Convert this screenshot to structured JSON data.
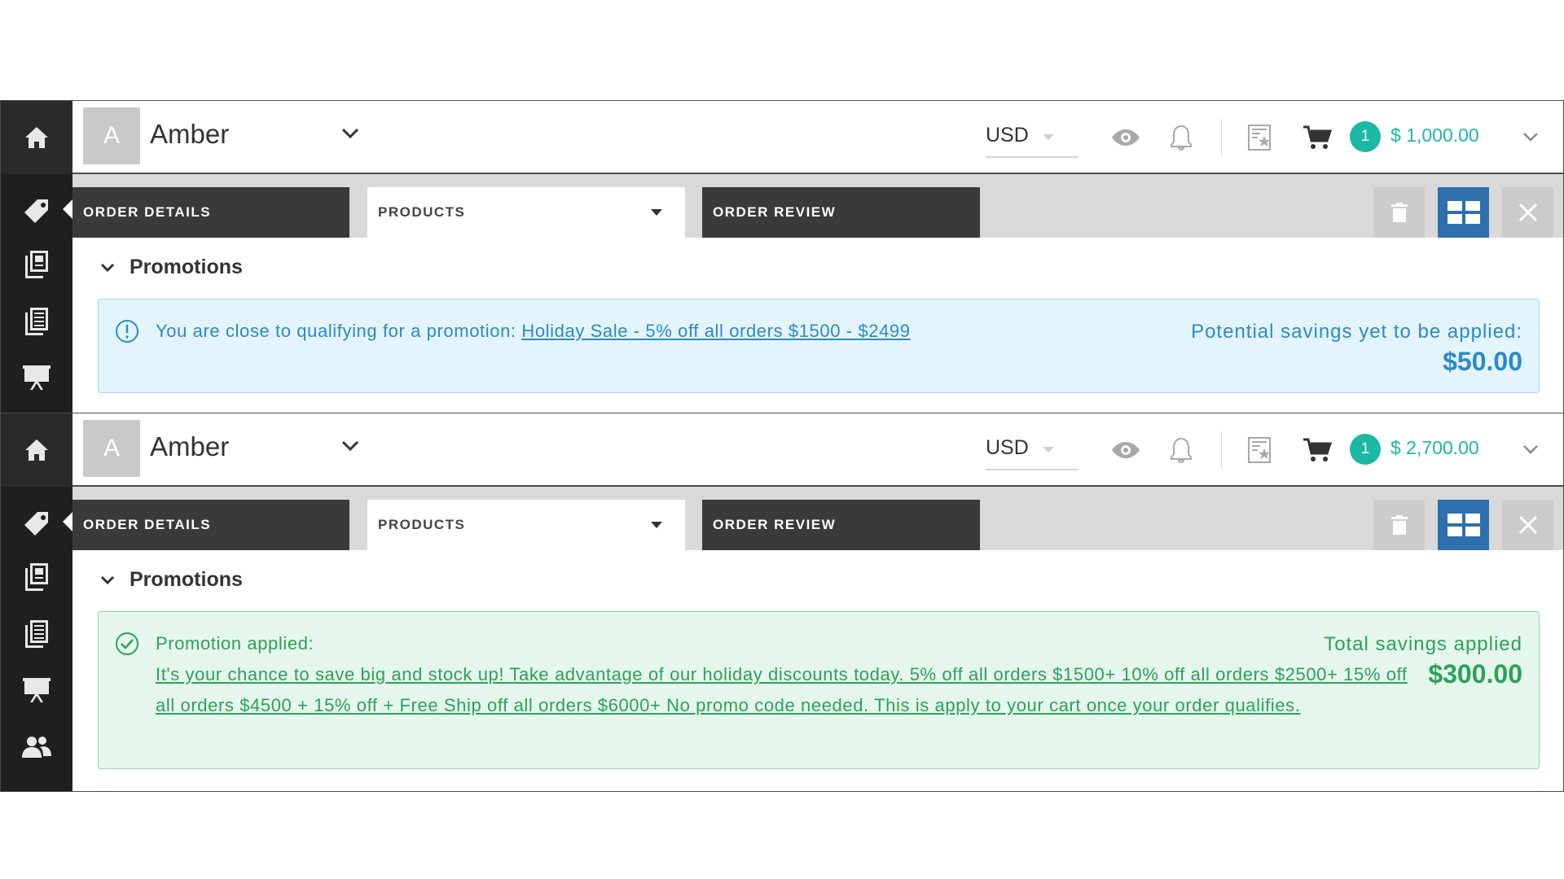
{
  "panels": [
    {
      "user": {
        "initial": "A",
        "name": "Amber"
      },
      "currency": "USD",
      "cart": {
        "count": "1",
        "total": "$ 1,000.00"
      },
      "tabs": {
        "order_details": "ORDER DETAILS",
        "products": "PRODUCTS",
        "order_review": "ORDER REVIEW"
      },
      "promotions": {
        "heading": "Promotions",
        "type": "info",
        "message": "You are close to qualifying for a promotion:",
        "link": "Holiday Sale - 5% off all orders $1500 - $2499",
        "savings_label": "Potential savings yet to be applied:",
        "savings_amount": "$50.00"
      }
    },
    {
      "user": {
        "initial": "A",
        "name": "Amber"
      },
      "currency": "USD",
      "cart": {
        "count": "1",
        "total": "$ 2,700.00"
      },
      "tabs": {
        "order_details": "ORDER DETAILS",
        "products": "PRODUCTS",
        "order_review": "ORDER REVIEW"
      },
      "promotions": {
        "heading": "Promotions",
        "type": "success",
        "message": "Promotion applied:",
        "link": "It's your chance to save big and stock up! Take advantage of our holiday discounts today. 5% off all orders $1500+ 10% off all orders $2500+ 15% off all orders $4500 + 15% off + Free Ship off all orders $6000+ No promo code needed. This is apply to your cart once your order qualifies.",
        "savings_label": "Total savings applied",
        "savings_amount": "$300.00"
      }
    }
  ],
  "icons": {
    "sidebar": [
      "home-icon",
      "tag-icon",
      "catalog-icon",
      "list-icon",
      "presentation-icon",
      "users-icon"
    ],
    "header": [
      "eye-icon",
      "bell-icon",
      "quote-icon",
      "cart-icon",
      "chevron-down-icon"
    ],
    "toolbar": [
      "trash-icon",
      "grid-view-icon",
      "close-icon"
    ]
  },
  "colors": {
    "accent_teal": "#1bb8a6",
    "info_blue": "#2c8ac7",
    "success_green": "#2da05a",
    "toolbar_blue": "#2f6fad",
    "sidebar_dark": "#1f1f1f"
  }
}
